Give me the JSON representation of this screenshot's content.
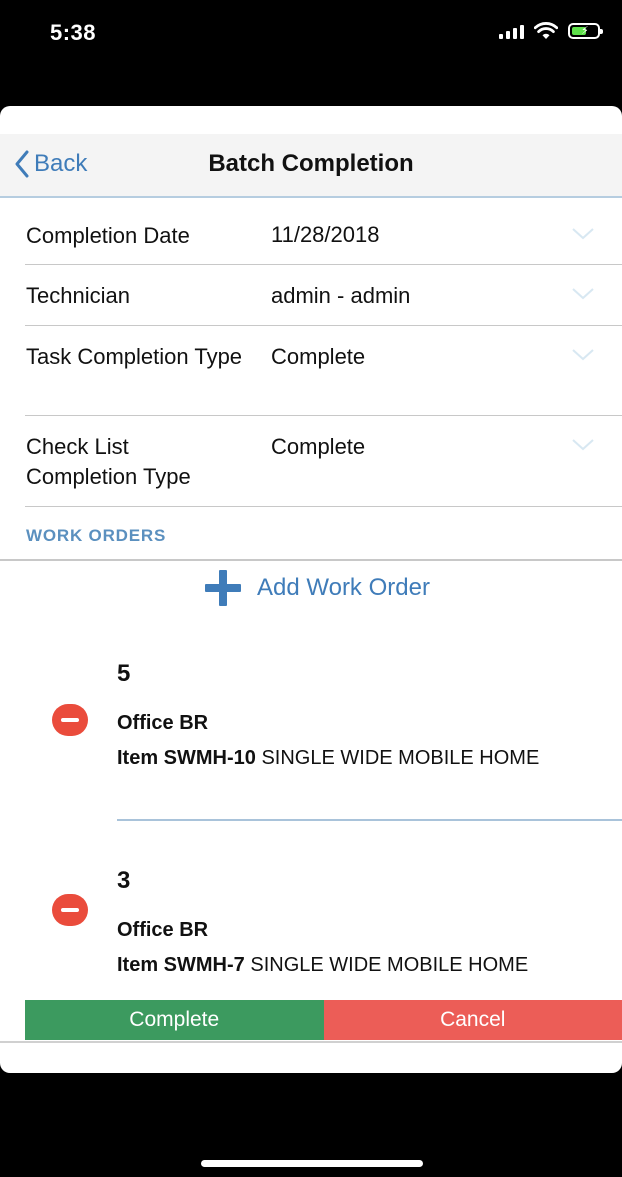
{
  "status_bar": {
    "time": "5:38"
  },
  "nav": {
    "back_label": "Back",
    "title": "Batch Completion"
  },
  "form": {
    "fields": [
      {
        "label": "Completion Date",
        "value": "11/28/2018"
      },
      {
        "label": "Technician",
        "value": "admin - admin"
      },
      {
        "label": "Task Completion Type",
        "value": "Complete"
      },
      {
        "label": "Check List Completion Type",
        "value": "Complete"
      }
    ]
  },
  "work_orders": {
    "section_title": "WORK ORDERS",
    "add_label": "Add Work Order",
    "items": [
      {
        "number": "5",
        "office": "Office BR",
        "item_code": "Item SWMH-10",
        "item_desc": " SINGLE WIDE MOBILE HOME"
      },
      {
        "number": "3",
        "office": "Office BR",
        "item_code": "Item SWMH-7",
        "item_desc": " SINGLE WIDE MOBILE HOME"
      }
    ]
  },
  "actions": {
    "complete_label": "Complete",
    "cancel_label": "Cancel"
  },
  "colors": {
    "accent_blue": "#3f7cb9",
    "complete_green": "#3c9a5f",
    "cancel_red": "#ec5d57",
    "remove_red": "#ea4c3c"
  }
}
